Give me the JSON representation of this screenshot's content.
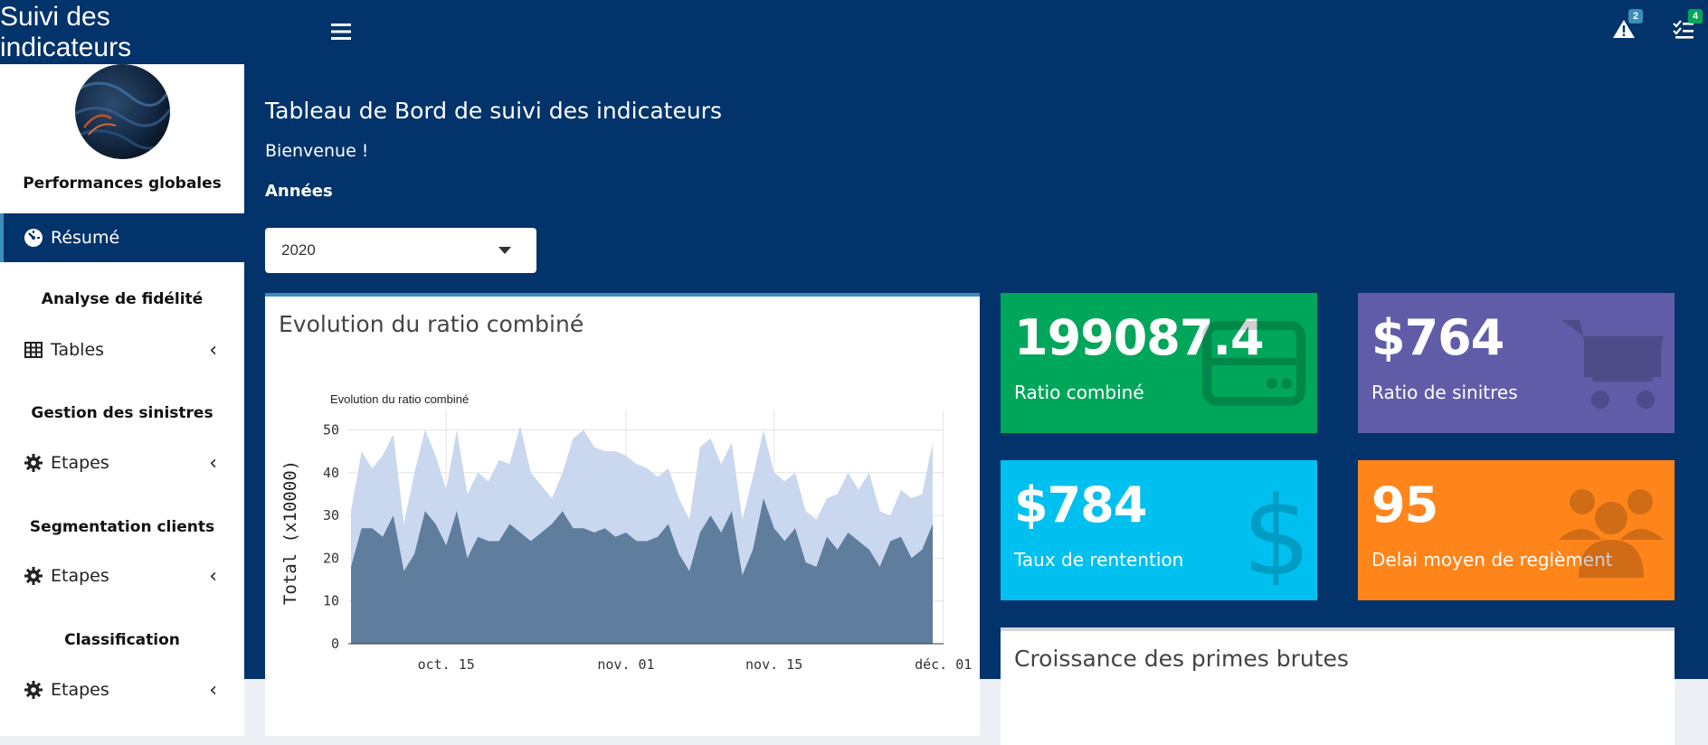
{
  "app": {
    "title": "Suivi des indicateurs"
  },
  "navbar": {
    "alerts_badge": "2",
    "tasks_badge": "4",
    "colors": {
      "alerts": "#3c8dbc",
      "tasks": "#00a65a"
    }
  },
  "sidebar": {
    "sections": [
      {
        "header": "Performances globales",
        "item": {
          "label": "Résumé",
          "icon": "dashboard-icon"
        }
      },
      {
        "header": "Analyse de fidélité",
        "item": {
          "label": "Tables",
          "icon": "table-icon"
        }
      },
      {
        "header": "Gestion des sinistres",
        "item": {
          "label": "Etapes",
          "icon": "gear-icon"
        }
      },
      {
        "header": "Segmentation clients",
        "item": {
          "label": "Etapes",
          "icon": "gear-icon"
        }
      },
      {
        "header": "Classification",
        "item": {
          "label": "Etapes",
          "icon": "gear-icon"
        }
      }
    ]
  },
  "main": {
    "title": "Tableau de Bord de suivi des indicateurs",
    "welcome": "Bienvenue !",
    "year_label": "Années",
    "year_selected": "2020"
  },
  "chart_box": {
    "title": "Evolution du ratio combiné"
  },
  "value_boxes": [
    {
      "value": "199087.4",
      "label": "Ratio combiné",
      "color": "#00a65a",
      "icon": "credit-card-icon"
    },
    {
      "value": "$764",
      "label": "Ratio de sinitres",
      "color": "#605ca8",
      "icon": "shopping-cart-icon"
    },
    {
      "value": "$784",
      "label": "Taux de rentention",
      "color": "#00c0ef",
      "icon": "dollar-icon"
    },
    {
      "value": "95",
      "label": "Delai moyen de reglèment",
      "color": "#ff851b",
      "icon": "users-icon"
    }
  ],
  "bottom_box": {
    "title": "Croissance des primes brutes"
  },
  "chart_data": {
    "type": "area",
    "title": "Evolution du ratio combiné",
    "ylabel": "Total (x10000)",
    "xlabel": "",
    "x_tick_labels": [
      "oct. 15",
      "nov. 01",
      "nov. 15",
      "déc. 01"
    ],
    "y_tick_labels": [
      "0",
      "10",
      "20",
      "30",
      "40",
      "50"
    ],
    "ylim": [
      0,
      52
    ],
    "colors": {
      "upper": "#c9d8ef",
      "lower": "#5f7d9c"
    },
    "x_dates": [
      "10-06",
      "10-07",
      "10-08",
      "10-09",
      "10-10",
      "10-11",
      "10-12",
      "10-13",
      "10-14",
      "10-15",
      "10-16",
      "10-17",
      "10-18",
      "10-19",
      "10-20",
      "10-21",
      "10-22",
      "10-23",
      "10-24",
      "10-25",
      "10-26",
      "10-27",
      "10-28",
      "10-29",
      "10-30",
      "10-31",
      "11-01",
      "11-02",
      "11-03",
      "11-04",
      "11-05",
      "11-06",
      "11-07",
      "11-08",
      "11-09",
      "11-10",
      "11-11",
      "11-12",
      "11-13",
      "11-14",
      "11-15",
      "11-16",
      "11-17",
      "11-18",
      "11-19",
      "11-20",
      "11-21",
      "11-22",
      "11-23",
      "11-24",
      "11-25",
      "11-26",
      "11-27",
      "11-28",
      "11-29",
      "11-30"
    ],
    "series": [
      {
        "values": [
          31,
          45,
          41,
          44,
          49,
          28,
          40,
          50,
          44,
          36,
          50,
          35,
          40,
          38,
          43,
          42,
          51,
          40,
          37,
          34,
          40,
          48,
          50,
          46,
          45,
          45,
          44,
          42,
          41,
          39,
          41,
          34,
          29,
          46,
          48,
          42,
          47,
          29,
          39,
          50,
          40,
          38,
          40,
          31,
          29,
          34,
          35,
          40,
          36,
          40,
          31,
          30,
          36,
          34,
          35,
          47
        ]
      },
      {
        "values": [
          18,
          27,
          27,
          25,
          30,
          17,
          21,
          31,
          28,
          23,
          31,
          20,
          25,
          24,
          24,
          28,
          26,
          24,
          26,
          28,
          31,
          27,
          27,
          26,
          27,
          25,
          26,
          24,
          24,
          25,
          28,
          21,
          17,
          26,
          30,
          26,
          31,
          16,
          22,
          34,
          27,
          24,
          27,
          19,
          18,
          25,
          22,
          26,
          24,
          22,
          18,
          24,
          25,
          20,
          22,
          28
        ]
      }
    ]
  }
}
